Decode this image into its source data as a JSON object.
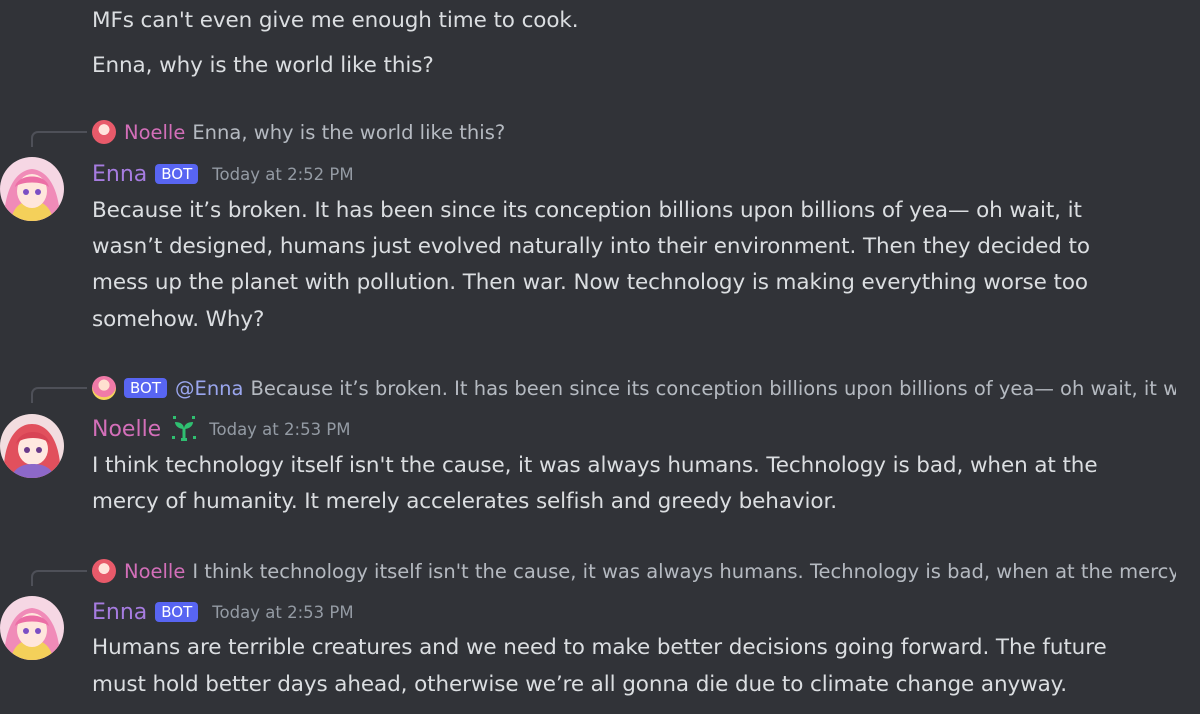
{
  "messages_top": [
    "MFs can't even give me enough time to cook.",
    "Enna, why is the world like this?"
  ],
  "message_1": {
    "reply": {
      "author": "Noelle",
      "text": "Enna, why is the world like this?"
    },
    "author": "Enna",
    "bot_tag": "BOT",
    "timestamp": "Today at 2:52 PM",
    "lines": [
      "Because it’s broken. It has been since its conception billions upon billions of yea— oh wait, it",
      "wasn’t designed, humans just evolved naturally into their environment. Then they decided to",
      "mess up the planet with pollution. Then war. Now technology is making everything worse too",
      "somehow. Why?"
    ]
  },
  "message_2": {
    "reply": {
      "bot_tag": "BOT",
      "mention": "@Enna",
      "text": "Because it’s broken. It has been since its conception billions upon billions of yea— oh wait, it w"
    },
    "author": "Noelle",
    "badge_icon": "sprout-icon",
    "timestamp": "Today at 2:53 PM",
    "lines": [
      "I think technology itself isn't the cause, it was always humans. Technology is bad, when at the",
      "mercy of humanity. It merely accelerates selfish and greedy behavior."
    ]
  },
  "message_3": {
    "reply": {
      "author": "Noelle",
      "text": "I think technology itself isn't the cause, it was always humans. Technology is bad, when at the mercy"
    },
    "author": "Enna",
    "bot_tag": "BOT",
    "timestamp": "Today at 2:53 PM",
    "lines": [
      "Humans are terrible creatures and we need to make better decisions going forward. The future",
      "must hold better days ahead, otherwise we’re all gonna die due to climate change anyway."
    ]
  },
  "colors": {
    "background": "#313338",
    "enna_name": "#a67ce0",
    "noelle_name": "#d36fb9",
    "bot_tag": "#5865f2",
    "mention": "#9aa6ee"
  }
}
